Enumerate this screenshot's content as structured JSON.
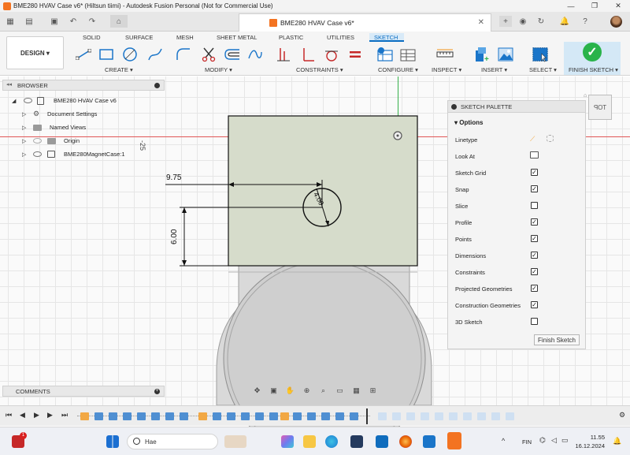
{
  "window": {
    "title": "BME280 HVAV Case v6* (Hiltsun tiimi) - Autodesk Fusion Personal (Not for Commercial Use)",
    "minimize": "—",
    "maximize": "❐",
    "close": "✕"
  },
  "tabs": {
    "document_tab": "BME280 HVAV Case v6*",
    "close": "✕"
  },
  "ribbon": {
    "workspace": "DESIGN",
    "tabs": [
      "SOLID",
      "SURFACE",
      "MESH",
      "SHEET METAL",
      "PLASTIC",
      "UTILITIES",
      "SKETCH"
    ],
    "active_tab": "SKETCH",
    "groups": {
      "create": "CREATE",
      "modify": "MODIFY",
      "constraints": "CONSTRAINTS",
      "configure": "CONFIGURE",
      "inspect": "INSPECT",
      "insert": "INSERT",
      "select": "SELECT",
      "finish_sketch": "FINISH SKETCH"
    }
  },
  "browser": {
    "header": "BROWSER",
    "items": [
      {
        "label": "BME280 HVAV Case v6"
      },
      {
        "label": "Document Settings"
      },
      {
        "label": "Named Views"
      },
      {
        "label": "Origin"
      },
      {
        "label": "BME280MagnetCase:1"
      }
    ]
  },
  "comments": {
    "header": "COMMENTS"
  },
  "sketch": {
    "axis_label": "-25",
    "dim_horizontal": "9.75",
    "dim_vertical": "6.00",
    "dim_diameter": "4.00"
  },
  "palette": {
    "header": "SKETCH PALETTE",
    "section": "Options",
    "rows": [
      {
        "label": "Linetype",
        "checked": null
      },
      {
        "label": "Look At",
        "checked": null
      },
      {
        "label": "Sketch Grid",
        "checked": true
      },
      {
        "label": "Snap",
        "checked": true
      },
      {
        "label": "Slice",
        "checked": false
      },
      {
        "label": "Profile",
        "checked": true
      },
      {
        "label": "Points",
        "checked": true
      },
      {
        "label": "Dimensions",
        "checked": true
      },
      {
        "label": "Constraints",
        "checked": true
      },
      {
        "label": "Projected Geometries",
        "checked": true
      },
      {
        "label": "Construction Geometries",
        "checked": true
      },
      {
        "label": "3D Sketch",
        "checked": false
      }
    ],
    "finish_button": "Finish Sketch"
  },
  "viewcube": {
    "face": "TOP"
  },
  "taskbar": {
    "search_placeholder": "Hae",
    "language": "FIN",
    "time": "11.55",
    "date": "16.12.2024",
    "notification_badge": "1"
  }
}
